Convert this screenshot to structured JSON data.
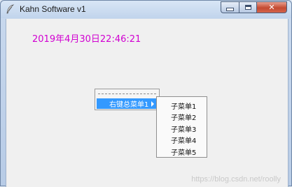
{
  "window": {
    "title": "Kahn Software v1",
    "close_glyph": "✕"
  },
  "clock": {
    "text": "2019年4月30日22:46:21",
    "color": "#d100d1"
  },
  "context_menu": {
    "item_label": "右键总菜单1",
    "highlight_color": "#3399ff"
  },
  "submenu": {
    "items": [
      "子菜单1",
      "子菜单2",
      "子菜单3",
      "子菜单4",
      "子菜单5"
    ]
  },
  "watermark": {
    "text": "https://blog.csdn.net/roolly"
  },
  "icons": {
    "app": "feather-icon",
    "minimize": "minimize-icon",
    "maximize": "maximize-icon",
    "close": "close-icon",
    "submenu_arrow": "chevron-right-icon"
  }
}
